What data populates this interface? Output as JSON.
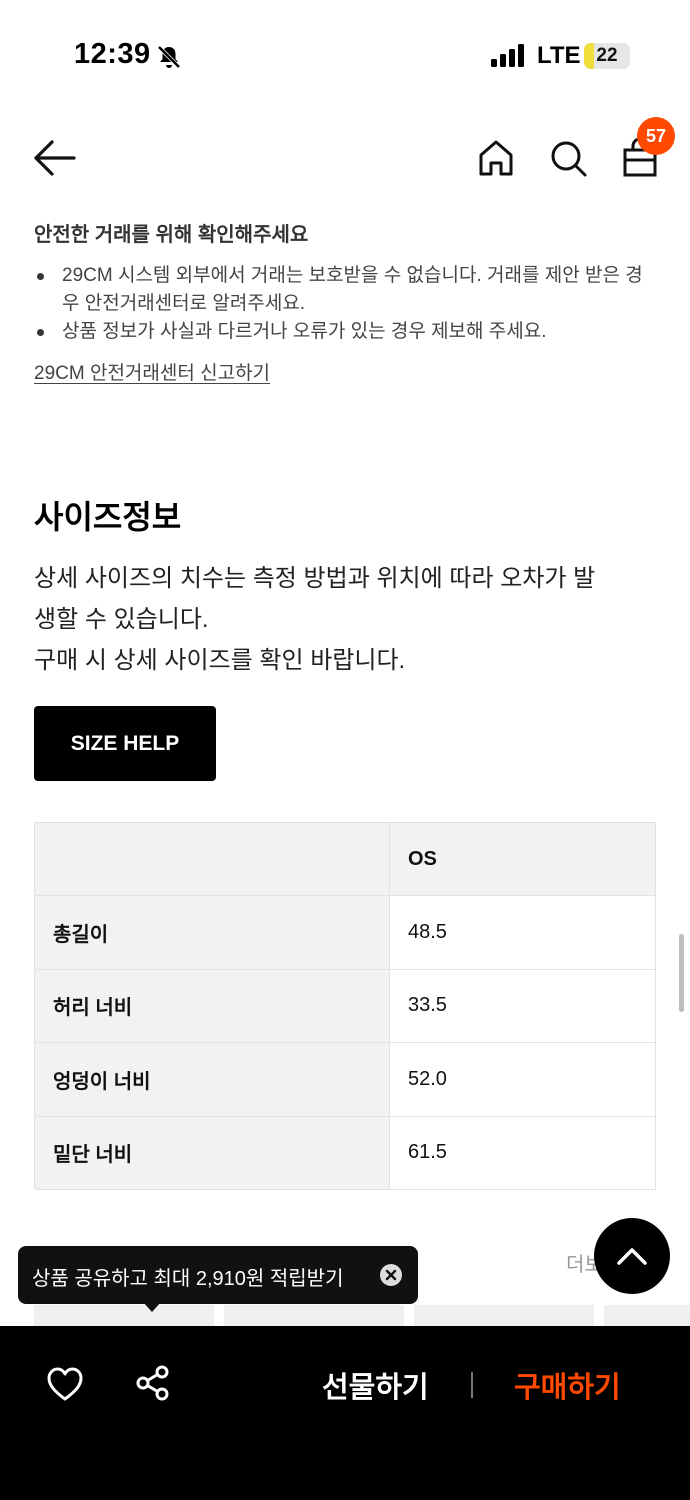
{
  "status_bar": {
    "time": "12:39",
    "network": "LTE",
    "battery_level": "22",
    "battery_fraction": 0.22
  },
  "nav": {
    "cart_count": "57",
    "icons": [
      "back-arrow-icon",
      "home-icon",
      "search-icon",
      "shopping-bag-icon"
    ]
  },
  "notice": {
    "title": "안전한 거래를 위해 확인해주세요",
    "items": [
      "29CM 시스템 외부에서 거래는 보호받을 수 없습니다. 거래를 제안 받은 경우 안전거래센터로 알려주세요.",
      "상품 정보가 사실과 다르거나 오류가 있는 경우 제보해 주세요."
    ],
    "link": "29CM 안전거래센터 신고하기"
  },
  "size_info": {
    "title": "사이즈정보",
    "description_line1": "상세 사이즈의 치수는 측정 방법과 위치에 따라 오차가 발",
    "description_line2": "생할 수 있습니다.",
    "description_line3": "구매 시 상세 사이즈를 확인 바랍니다.",
    "help_button": "SIZE HELP",
    "table": {
      "header": [
        "",
        "OS"
      ],
      "rows": [
        [
          "총길이",
          "48.5"
        ],
        [
          "허리 너비",
          "33.5"
        ],
        [
          "엉덩이 너비",
          "52.0"
        ],
        [
          "밑단 너비",
          "61.5"
        ]
      ]
    }
  },
  "more_label": "더보",
  "tooltip": {
    "text": "상품 공유하고 최대 2,910원 적립받기"
  },
  "bottom_bar": {
    "gift_label": "선물하기",
    "buy_label": "구매하기"
  },
  "colors": {
    "accent": "#ff4800",
    "battery": "#f0de3a",
    "bottom_bar": "#000000"
  }
}
